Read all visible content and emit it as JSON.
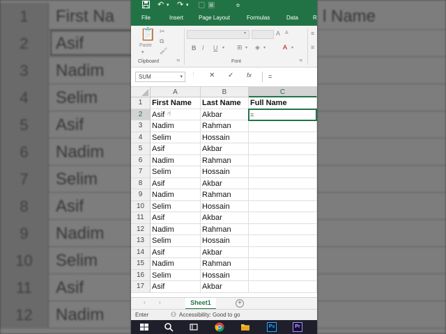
{
  "background": {
    "left_rows": [
      {
        "num": "1",
        "text": "First Na"
      },
      {
        "num": "2",
        "text": "Asif"
      },
      {
        "num": "3",
        "text": "Nadim"
      },
      {
        "num": "4",
        "text": "Selim"
      },
      {
        "num": "5",
        "text": "Asif"
      },
      {
        "num": "6",
        "text": "Nadim"
      },
      {
        "num": "7",
        "text": "Selim"
      },
      {
        "num": "8",
        "text": "Asif"
      },
      {
        "num": "9",
        "text": "Nadim"
      },
      {
        "num": "10",
        "text": "Selim"
      },
      {
        "num": "11",
        "text": "Asif"
      },
      {
        "num": "12",
        "text": "Nadim"
      }
    ],
    "right_header": "l Name"
  },
  "quick_access": {
    "save_icon": "save-icon",
    "undo_icon": "undo-icon",
    "redo_icon": "redo-icon"
  },
  "ribbon_tabs": [
    "File",
    "Insert",
    "Page Layout",
    "Formulas",
    "Data",
    "R"
  ],
  "ribbon": {
    "paste_label": "Paste",
    "clipboard_label": "Clipboard",
    "font_label": "Font",
    "bold": "B",
    "italic": "I",
    "underline": "U",
    "font_color": "A"
  },
  "formula_bar": {
    "name_box": "SUM",
    "cancel": "✕",
    "enter": "✓",
    "fx": "fx",
    "content": "="
  },
  "columns": [
    "A",
    "B",
    "C"
  ],
  "rows": [
    {
      "num": "1",
      "a": "First Name",
      "b": "Last Name",
      "c": "Full Name"
    },
    {
      "num": "2",
      "a": "Asif",
      "b": "Akbar",
      "c": "="
    },
    {
      "num": "3",
      "a": "Nadim",
      "b": "Rahman",
      "c": ""
    },
    {
      "num": "4",
      "a": "Selim",
      "b": "Hossain",
      "c": ""
    },
    {
      "num": "5",
      "a": "Asif",
      "b": "Akbar",
      "c": ""
    },
    {
      "num": "6",
      "a": "Nadim",
      "b": "Rahman",
      "c": ""
    },
    {
      "num": "7",
      "a": "Selim",
      "b": "Hossain",
      "c": ""
    },
    {
      "num": "8",
      "a": "Asif",
      "b": "Akbar",
      "c": ""
    },
    {
      "num": "9",
      "a": "Nadim",
      "b": "Rahman",
      "c": ""
    },
    {
      "num": "10",
      "a": "Selim",
      "b": "Hossain",
      "c": ""
    },
    {
      "num": "11",
      "a": "Asif",
      "b": "Akbar",
      "c": ""
    },
    {
      "num": "12",
      "a": "Nadim",
      "b": "Rahman",
      "c": ""
    },
    {
      "num": "13",
      "a": "Selim",
      "b": "Hossain",
      "c": ""
    },
    {
      "num": "14",
      "a": "Asif",
      "b": "Akbar",
      "c": ""
    },
    {
      "num": "15",
      "a": "Nadim",
      "b": "Rahman",
      "c": ""
    },
    {
      "num": "16",
      "a": "Selim",
      "b": "Hossain",
      "c": ""
    },
    {
      "num": "17",
      "a": "Asif",
      "b": "Akbar",
      "c": ""
    }
  ],
  "sheet_tabs": {
    "active": "Sheet1",
    "add": "+"
  },
  "status_bar": {
    "mode": "Enter",
    "accessibility": "Accessibility: Good to go"
  },
  "taskbar": {
    "ps": "Ps",
    "pr": "Pr"
  },
  "colors": {
    "excel_green": "#217346",
    "ps_blue": "#31a8ff",
    "pr_purple": "#9999ff"
  }
}
